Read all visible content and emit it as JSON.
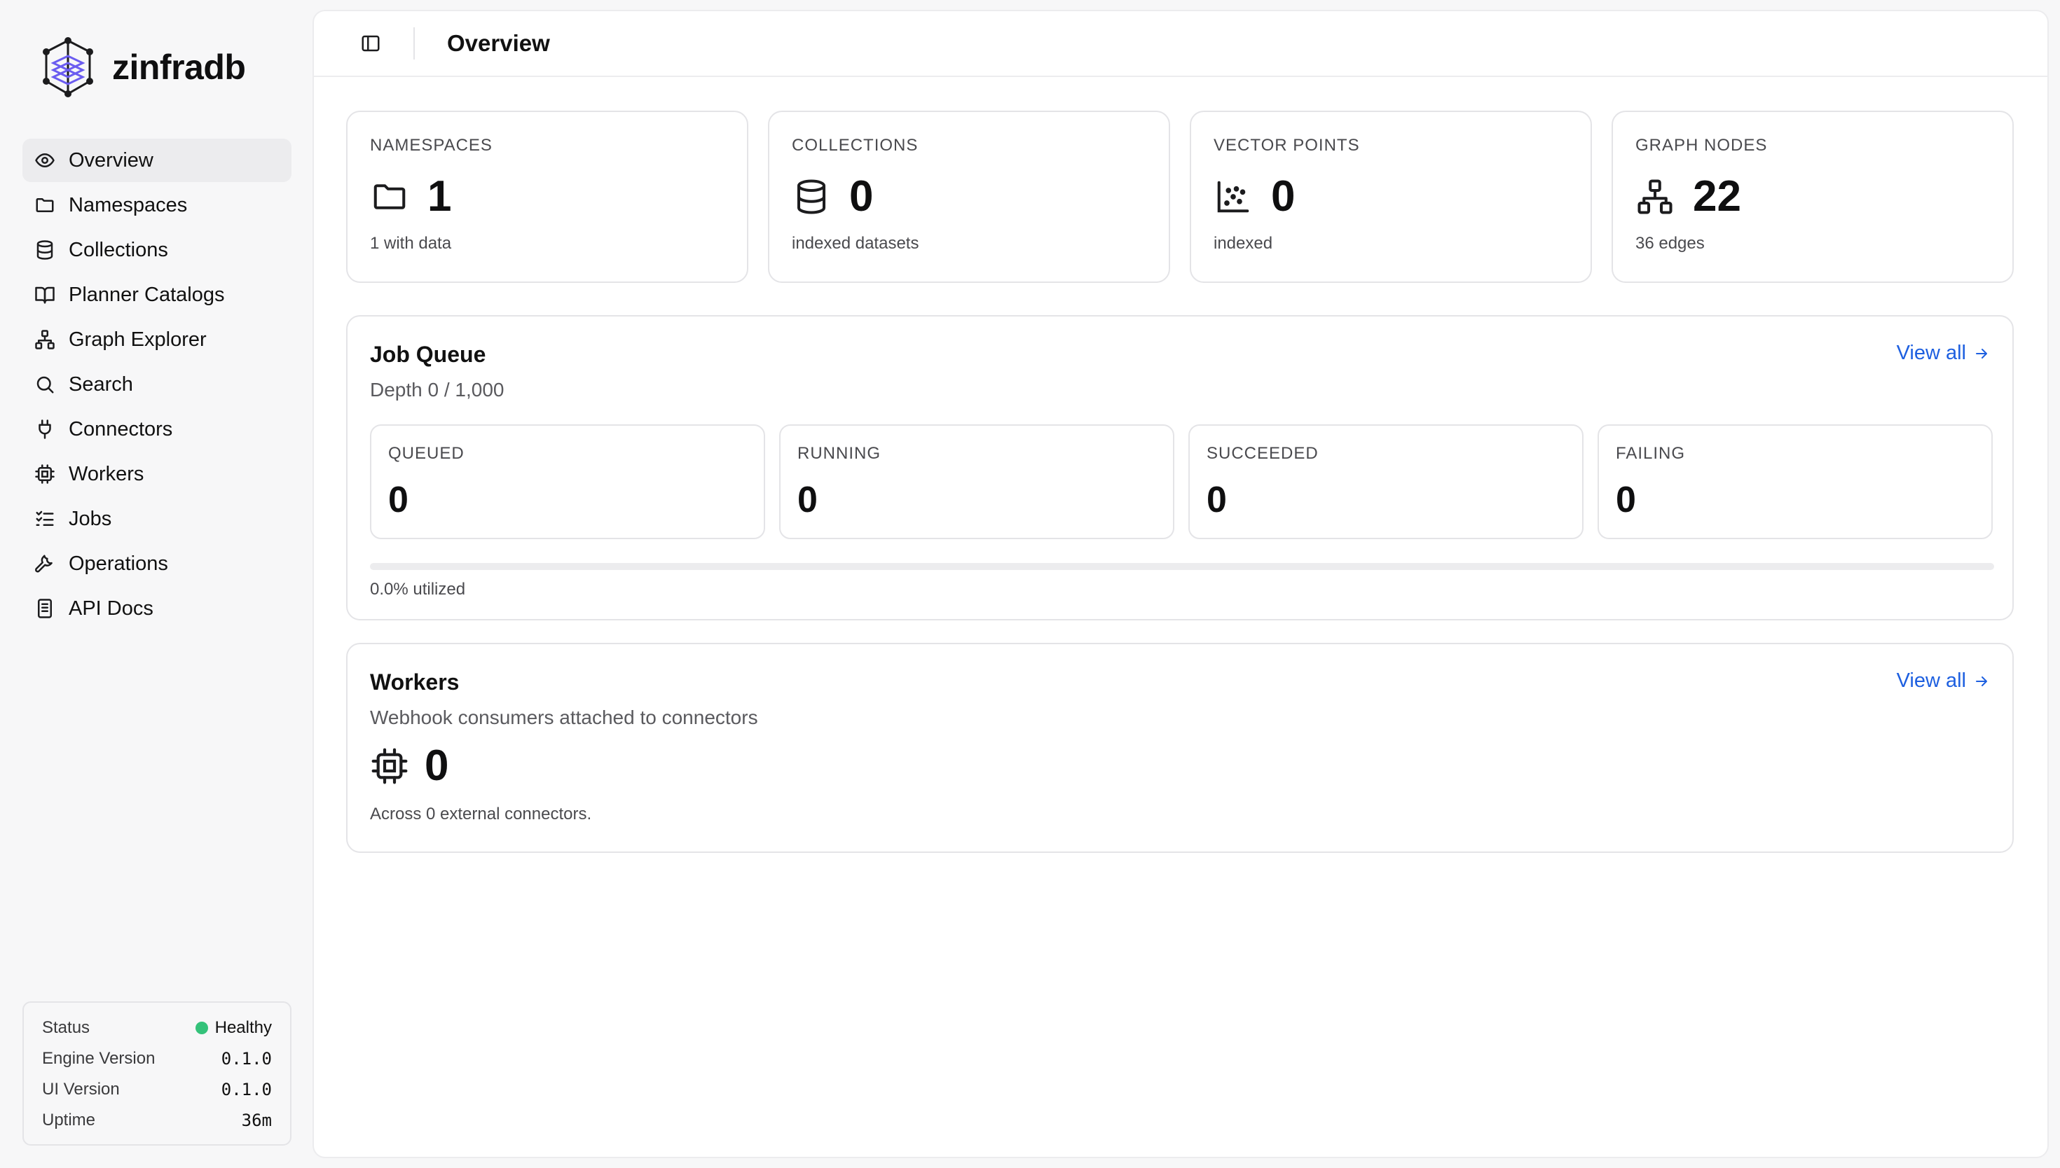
{
  "app": {
    "name": "zinfradb"
  },
  "sidebar": {
    "items": [
      {
        "label": "Overview",
        "icon": "eye-icon",
        "active": true
      },
      {
        "label": "Namespaces",
        "icon": "folder-icon"
      },
      {
        "label": "Collections",
        "icon": "database-icon"
      },
      {
        "label": "Planner Catalogs",
        "icon": "book-icon"
      },
      {
        "label": "Graph Explorer",
        "icon": "network-icon"
      },
      {
        "label": "Search",
        "icon": "search-icon"
      },
      {
        "label": "Connectors",
        "icon": "plug-icon"
      },
      {
        "label": "Workers",
        "icon": "cpu-icon"
      },
      {
        "label": "Jobs",
        "icon": "list-checks-icon"
      },
      {
        "label": "Operations",
        "icon": "wrench-icon"
      },
      {
        "label": "API Docs",
        "icon": "document-icon"
      }
    ]
  },
  "status": {
    "status_label": "Status",
    "status_value": "Healthy",
    "engine_label": "Engine Version",
    "engine_value": "0.1.0",
    "ui_label": "UI Version",
    "ui_value": "0.1.0",
    "uptime_label": "Uptime",
    "uptime_value": "36m",
    "healthy_color": "#34c27a"
  },
  "header": {
    "title": "Overview"
  },
  "stats": [
    {
      "label": "NAMESPACES",
      "value": "1",
      "sub": "1 with data",
      "icon": "folder-icon"
    },
    {
      "label": "COLLECTIONS",
      "value": "0",
      "sub": "indexed datasets",
      "icon": "database-icon"
    },
    {
      "label": "VECTOR POINTS",
      "value": "0",
      "sub": "indexed",
      "icon": "scatter-chart-icon"
    },
    {
      "label": "GRAPH NODES",
      "value": "22",
      "sub": "36 edges",
      "icon": "network-icon"
    }
  ],
  "job_queue": {
    "title": "Job Queue",
    "subtitle": "Depth 0 / 1,000",
    "view_all": "View all",
    "stats": [
      {
        "label": "QUEUED",
        "value": "0"
      },
      {
        "label": "RUNNING",
        "value": "0"
      },
      {
        "label": "SUCCEEDED",
        "value": "0"
      },
      {
        "label": "FAILING",
        "value": "0"
      }
    ],
    "utilization": 0.0,
    "utilization_text": "0.0% utilized"
  },
  "workers": {
    "title": "Workers",
    "subtitle": "Webhook consumers attached to connectors",
    "view_all": "View all",
    "value": "0",
    "note": "Across 0 external connectors.",
    "icon": "cpu-icon"
  },
  "accent_color": "#1d5fe0"
}
